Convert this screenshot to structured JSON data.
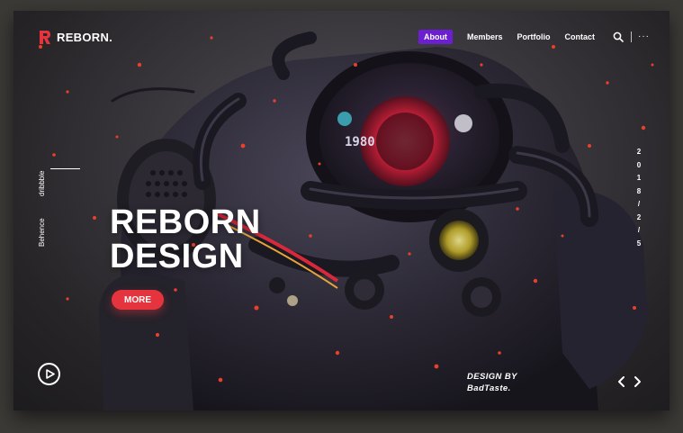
{
  "brand": {
    "name": "REBORN.",
    "accent": "#e5343d"
  },
  "nav": {
    "items": [
      {
        "label": "About",
        "active": true
      },
      {
        "label": "Members",
        "active": false
      },
      {
        "label": "Portfolio",
        "active": false
      },
      {
        "label": "Contact",
        "active": false
      }
    ],
    "active_color": "#6c1fd1",
    "search_icon": "search-icon",
    "more_icon": "more-dots-icon",
    "more_label": "···"
  },
  "social": {
    "dribbble": "dribbble",
    "behance": "Behence"
  },
  "hero": {
    "title_line1": "REBORN",
    "title_line2": "DESIGN",
    "button_label": "MORE",
    "art_readout": "1980"
  },
  "date": [
    "2",
    "0",
    "1",
    "8",
    "/",
    "2",
    "/",
    "5"
  ],
  "credit": {
    "line1": "DESIGN BY",
    "line2": "BadTaste."
  },
  "controls": {
    "play_icon": "play-icon",
    "prev_icon": "chevron-left-icon",
    "next_icon": "chevron-right-icon"
  }
}
